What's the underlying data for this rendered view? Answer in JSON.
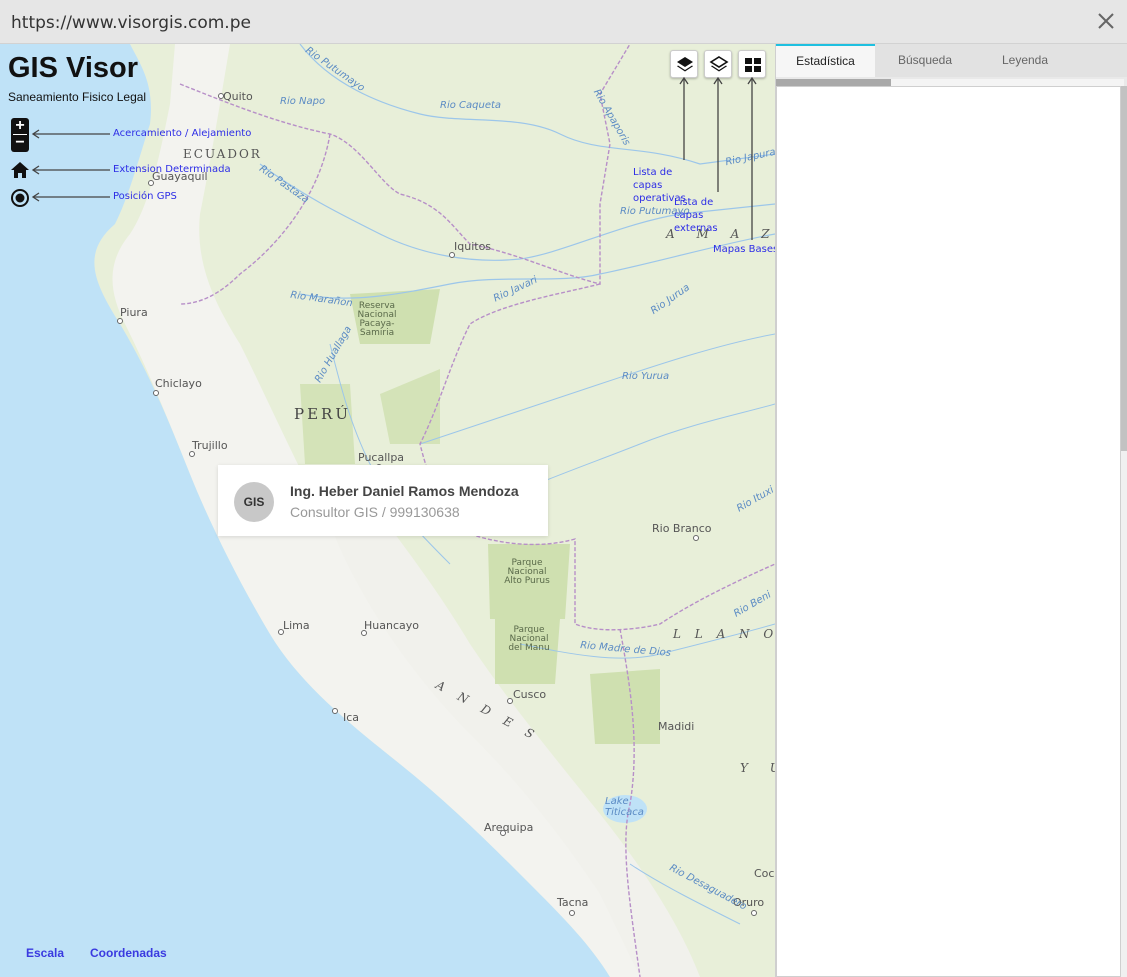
{
  "window": {
    "url": "https://www.visorgis.com.pe",
    "close_icon": "close-icon"
  },
  "app": {
    "title": "GIS Visor",
    "subtitle": "Saneamiento Fisico Legal"
  },
  "map_controls": {
    "zoom_in": "+",
    "zoom_out": "−",
    "home_icon": "home-icon",
    "gps_icon": "gps-target-icon"
  },
  "annotations": {
    "zoom": "Acercamiento / Alejamiento",
    "extent": "Extension Determinada",
    "gps": "Posición GPS",
    "operational_layers": "Lista de capas operativas",
    "external_layers": "Lista de capas externas",
    "basemaps": "Mapas Bases"
  },
  "toolbar": {
    "operational_layers_icon": "layers-icon",
    "external_layers_icon": "layers-icon",
    "basemaps_icon": "grid-icon"
  },
  "map_labels": {
    "quito": "Quito",
    "ecuador": "ECUADOR",
    "guayaquil": "Guayaquil",
    "iquitos": "Iquitos",
    "piura": "Piura",
    "chiclayo": "Chiclayo",
    "peru": "PERÚ",
    "trujillo": "Trujillo",
    "pucallpa": "Pucallpa",
    "rio_branco": "Rio Branco",
    "lima": "Lima",
    "huancayo": "Huancayo",
    "cusco": "Cusco",
    "ica": "Ica",
    "arequipa": "Arequipa",
    "tacna": "Tacna",
    "oruro": "Oruro",
    "madidi": "Madidi",
    "lake": "Lake Titicaca",
    "amazo": "A M A Z O",
    "llanos": "L L A N O S  D E",
    "andes": "A N D E S",
    "yu": "Y U",
    "rio_putumayo": "Rio Putumayo",
    "rio_napo": "Rio Napo",
    "rio_caqueta": "Rio Caqueta",
    "rio_apaporis": "Rio Apaporis",
    "rio_japura": "Rio Japura",
    "rio_pastaza": "Rio Pastaza",
    "rio_putumayo2": "Rio Putumayo",
    "rio_maranon": "Rio Marañon",
    "rio_javari": "Rio Javari",
    "rio_jurua": "Rio Jurua",
    "rio_yurua": "Rio Yurua",
    "rio_huallaga": "Rio Huallaga",
    "rio_ituxi": "Rio Ituxi",
    "rio_beni": "Rio Beni",
    "rio_madre": "Rio Madre de Dios",
    "rio_desaguadero": "Rio Desaguadero",
    "park_pacaya": "Reserva Nacional Pacaya-Samiria",
    "park_alto_purus": "Parque Nacional Alto Purus",
    "park_manu": "Parque Nacional del Manu",
    "coc": "Coc"
  },
  "card": {
    "avatar_text": "GIS",
    "name": "Ing. Heber Daniel Ramos Mendoza",
    "role": "Consultor GIS / 999130638"
  },
  "footer": {
    "scale": "Escala",
    "coordinates": "Coordenadas"
  },
  "panel": {
    "tabs": [
      {
        "label": "Estadística",
        "active": true
      },
      {
        "label": "Búsqueda",
        "active": false
      },
      {
        "label": "Leyenda",
        "active": false
      }
    ],
    "progress_fraction": 0.33,
    "accent_color": "#1ec0e0"
  },
  "colors": {
    "ocean": "#bfe2f7",
    "land": "#eaf0dc",
    "highlands": "#f2f2ee",
    "annotation": "#2d2de6"
  }
}
